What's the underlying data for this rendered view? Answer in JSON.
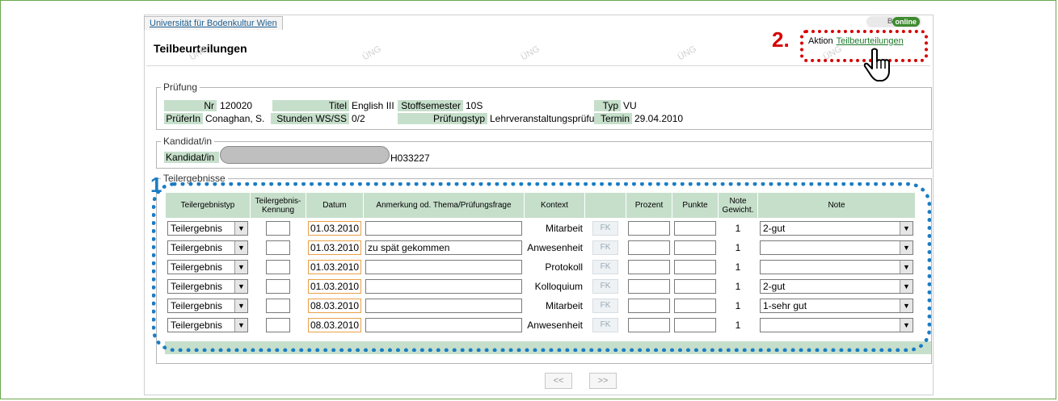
{
  "header": {
    "university_tab": "Universität für Bodenkultur Wien",
    "logo_left": "BOKU",
    "logo_right": "online",
    "page_title": "Teilbeurteilungen",
    "watermark": "ÜNG",
    "aktion_label": "Aktion",
    "aktion_link": "Teilbeurteilungen",
    "callout_number": "2."
  },
  "pruefung": {
    "legend": "Prüfung",
    "nr_label": "Nr",
    "nr_value": "120020",
    "titel_label": "Titel",
    "titel_value": "English III",
    "stoffsemester_label": "Stoffsemester",
    "stoffsemester_value": "10S",
    "typ_label": "Typ",
    "typ_value": "VU",
    "pruefer_label": "PrüferIn",
    "pruefer_value": "Conaghan, S.",
    "stunden_label": "Stunden WS/SS",
    "stunden_value": "0/2",
    "pruefungstyp_label": "Prüfungstyp",
    "pruefungstyp_value": "Lehrveranstaltungsprüfung",
    "termin_label": "Termin",
    "termin_value": "29.04.2010"
  },
  "kandidat": {
    "legend": "Kandidat/in",
    "label": "Kandidat/in",
    "code": "H033227"
  },
  "teilergebnisse": {
    "legend": "Teilergebnisse",
    "callout_number": "1",
    "columns": {
      "typ": "Teilergebnistyp",
      "kennung": "Teilergebnis-Kennung",
      "datum": "Datum",
      "anmerkung": "Anmerkung od. Thema/Prüfungsfrage",
      "kontext": "Kontext",
      "prozent": "Prozent",
      "punkte": "Punkte",
      "gewicht": "Note Gewicht.",
      "note": "Note"
    },
    "fk_label": "FK",
    "rows": [
      {
        "typ": "Teilergebnis",
        "kennung": "",
        "datum": "01.03.2010",
        "anmerkung": "",
        "kontext": "Mitarbeit",
        "prozent": "",
        "punkte": "",
        "gewicht": "1",
        "note": "2-gut"
      },
      {
        "typ": "Teilergebnis",
        "kennung": "",
        "datum": "01.03.2010",
        "anmerkung": "zu spät gekommen",
        "kontext": "Anwesenheit",
        "prozent": "",
        "punkte": "",
        "gewicht": "1",
        "note": ""
      },
      {
        "typ": "Teilergebnis",
        "kennung": "",
        "datum": "01.03.2010",
        "anmerkung": "",
        "kontext": "Protokoll",
        "prozent": "",
        "punkte": "",
        "gewicht": "1",
        "note": ""
      },
      {
        "typ": "Teilergebnis",
        "kennung": "",
        "datum": "01.03.2010",
        "anmerkung": "",
        "kontext": "Kolloquium",
        "prozent": "",
        "punkte": "",
        "gewicht": "1",
        "note": "2-gut"
      },
      {
        "typ": "Teilergebnis",
        "kennung": "",
        "datum": "08.03.2010",
        "anmerkung": "",
        "kontext": "Mitarbeit",
        "prozent": "",
        "punkte": "",
        "gewicht": "1",
        "note": "1-sehr gut"
      },
      {
        "typ": "Teilergebnis",
        "kennung": "",
        "datum": "08.03.2010",
        "anmerkung": "",
        "kontext": "Anwesenheit",
        "prozent": "",
        "punkte": "",
        "gewicht": "1",
        "note": ""
      }
    ]
  },
  "pager": {
    "prev": "<<",
    "next": ">>"
  },
  "colors": {
    "label_bg": "#c6dfcb",
    "callout_blue": "#1a7dc4",
    "callout_red": "#d60000",
    "date_border": "#e8a04a"
  },
  "icons": {
    "dropdown": "triangle-down",
    "pointer": "hand-pointer-icon"
  }
}
